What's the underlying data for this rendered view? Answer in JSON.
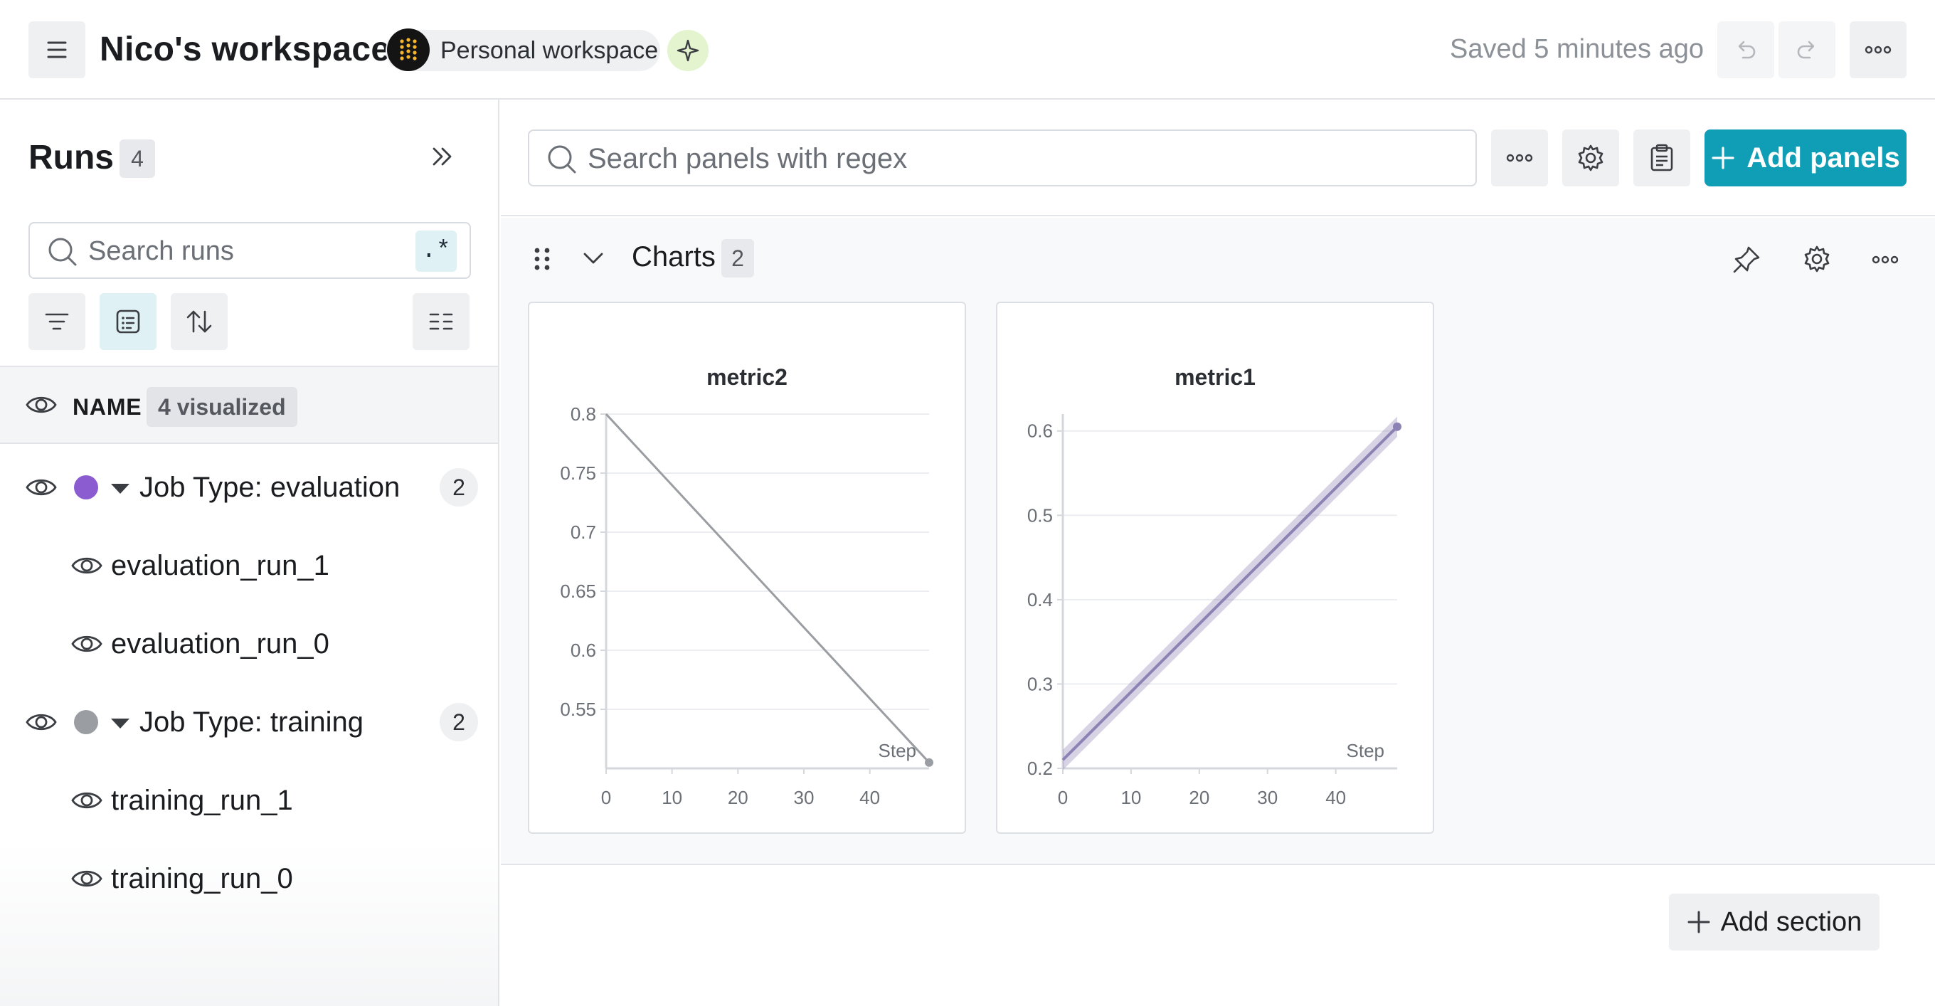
{
  "header": {
    "workspace_title": "Nico's workspace",
    "badge_text": "Personal workspace",
    "saved_text": "Saved 5 minutes ago"
  },
  "sidebar": {
    "title": "Runs",
    "run_count": "4",
    "search_placeholder": "Search runs",
    "regex_label": ".*",
    "name_header": "NAME",
    "visualized_badge": "4 visualized",
    "groups": [
      {
        "label": "Job Type: evaluation",
        "count": "2",
        "color": "#8a5cd0",
        "runs": [
          "evaluation_run_1",
          "evaluation_run_0"
        ]
      },
      {
        "label": "Job Type: training",
        "count": "2",
        "color": "#9a9da2",
        "runs": [
          "training_run_1",
          "training_run_0"
        ]
      }
    ]
  },
  "toolbar": {
    "search_placeholder": "Search panels with regex",
    "add_panels_label": "Add panels"
  },
  "section": {
    "title": "Charts",
    "count": "2",
    "add_section_label": "Add section"
  },
  "colors": {
    "accent": "#0f9eb5",
    "evaluation": "#8a5cd0",
    "training": "#9a9da2"
  },
  "chart_data": [
    {
      "type": "line",
      "title": "metric2",
      "xlabel": "Step",
      "ylabel": "",
      "xlim": [
        0,
        49
      ],
      "ylim": [
        0.5,
        0.8
      ],
      "xticks": [
        0,
        10,
        20,
        30,
        40
      ],
      "yticks": [
        0.55,
        0.6,
        0.65,
        0.7,
        0.75,
        0.8
      ],
      "grid": true,
      "series": [
        {
          "x": [
            0,
            49
          ],
          "y": [
            0.8,
            0.505
          ],
          "color": "#9a9da2"
        }
      ]
    },
    {
      "type": "line",
      "title": "metric1",
      "xlabel": "Step",
      "ylabel": "",
      "xlim": [
        0,
        49
      ],
      "ylim": [
        0.2,
        0.62
      ],
      "xticks": [
        0,
        10,
        20,
        30,
        40
      ],
      "yticks": [
        0.2,
        0.3,
        0.4,
        0.5,
        0.6
      ],
      "grid": true,
      "series": [
        {
          "x": [
            0,
            49
          ],
          "y": [
            0.21,
            0.605
          ],
          "band": 0.012,
          "color": "#8c82b4"
        }
      ]
    }
  ]
}
